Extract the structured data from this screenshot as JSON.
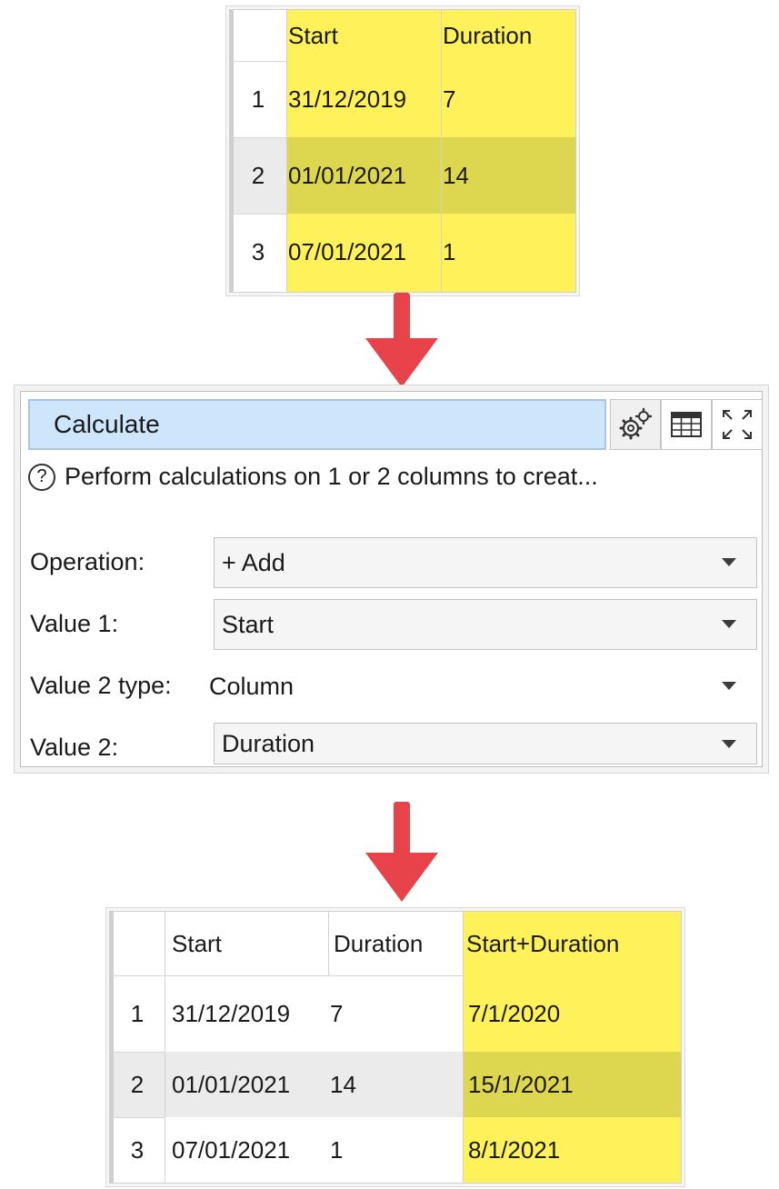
{
  "input_table": {
    "headers": [
      "Start",
      "Duration"
    ],
    "rows": [
      {
        "num": "1",
        "start": "31/12/2019",
        "duration": "7"
      },
      {
        "num": "2",
        "start": "01/01/2021",
        "duration": "14"
      },
      {
        "num": "3",
        "start": "07/01/2021",
        "duration": "1"
      }
    ]
  },
  "panel": {
    "title": "Calculate",
    "help_text": "Perform calculations on 1 or 2 columns to creat...",
    "help_icon": "?",
    "fields": [
      {
        "label": "Operation:",
        "value": "+ Add"
      },
      {
        "label": "Value 1:",
        "value": "Start"
      },
      {
        "label": "Value 2 type:",
        "value": "Column"
      },
      {
        "label": "Value 2:",
        "value": "Duration"
      }
    ],
    "icons": [
      "gears-icon",
      "table-icon",
      "expand-icon"
    ]
  },
  "output_table": {
    "headers": [
      "Start",
      "Duration",
      "Start+Duration"
    ],
    "rows": [
      {
        "num": "1",
        "start": "31/12/2019",
        "duration": "7",
        "result": "7/1/2020"
      },
      {
        "num": "2",
        "start": "01/01/2021",
        "duration": "14",
        "result": "15/1/2021"
      },
      {
        "num": "3",
        "start": "07/01/2021",
        "duration": "1",
        "result": "8/1/2021"
      }
    ]
  },
  "colors": {
    "highlight": "#fff15a",
    "highlight_dark": "#ddd64f",
    "arrow": "#e8434a",
    "title_box": "#cde6fb"
  }
}
